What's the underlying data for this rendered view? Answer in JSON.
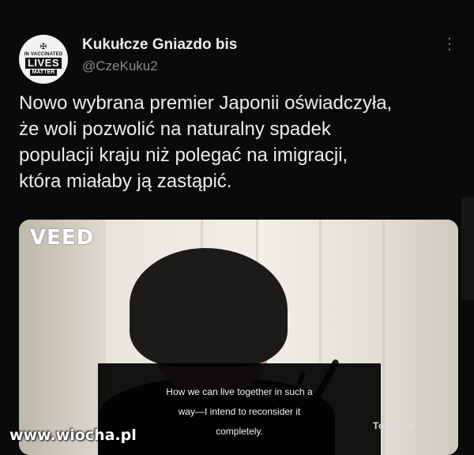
{
  "author": {
    "display_name": "Kukułcze Gniazdo bis",
    "handle": "@CzeKuku2",
    "avatar": {
      "top_text": "IN VACCINATED",
      "main_text": "LIVES",
      "bottom_text": "MATTER"
    }
  },
  "more_icon": "more-horizontal-icon",
  "tweet": {
    "lines": [
      "Nowo wybrana premier Japonii oświadczyła,",
      "że woli pozwolić na naturalny spadek",
      "populacji kraju niż polegać na imigracji,",
      "która miałaby ją zastąpić."
    ]
  },
  "media": {
    "watermark": "VEED",
    "subtitle_lines": [
      "How we can live together in such a",
      "way—I intend to reconsider it",
      "completely."
    ],
    "channel_logo": "TokyoTV"
  },
  "site_watermark": "www.wiocha.pl"
}
